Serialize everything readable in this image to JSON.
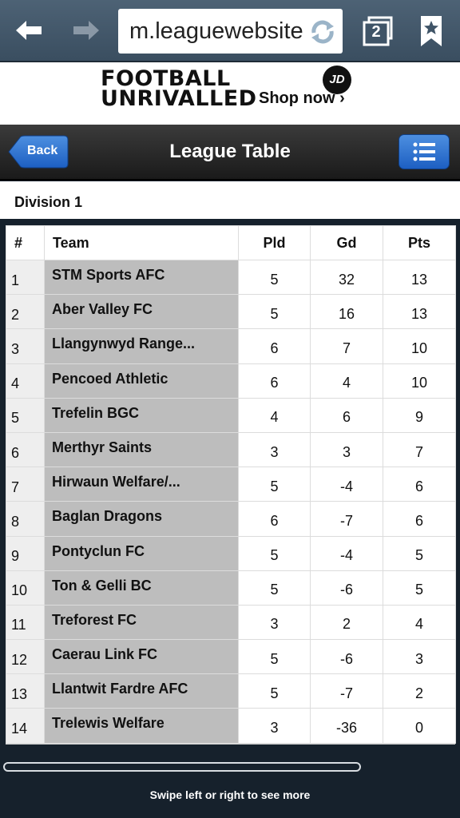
{
  "browser": {
    "url": "m.leaguewebsite",
    "tab_count": "2",
    "icons": {
      "back": "left-arrow-icon",
      "forward": "right-arrow-icon",
      "reload": "reload-icon",
      "tabs": "tabs-icon",
      "bookmark": "bookmark-star-icon"
    }
  },
  "ad": {
    "line1": "FOOTBALL",
    "line2": "UNRIVALLED",
    "cta": "Shop now ›",
    "logo": "JD"
  },
  "header": {
    "back_label": "Back",
    "title": "League Table",
    "menu_icon": "list-menu-icon",
    "accent": "#2a6fd4"
  },
  "division": "Division 1",
  "table": {
    "columns": [
      "#",
      "Team",
      "Pld",
      "Gd",
      "Pts"
    ],
    "rows": [
      {
        "pos": "1",
        "team": "STM Sports AFC",
        "pld": "5",
        "gd": "32",
        "pts": "13"
      },
      {
        "pos": "2",
        "team": "Aber Valley FC",
        "pld": "5",
        "gd": "16",
        "pts": "13"
      },
      {
        "pos": "3",
        "team": "Llangynwyd Range...",
        "pld": "6",
        "gd": "7",
        "pts": "10"
      },
      {
        "pos": "4",
        "team": "Pencoed Athletic",
        "pld": "6",
        "gd": "4",
        "pts": "10"
      },
      {
        "pos": "5",
        "team": "Trefelin BGC",
        "pld": "4",
        "gd": "6",
        "pts": "9"
      },
      {
        "pos": "6",
        "team": "Merthyr Saints",
        "pld": "3",
        "gd": "3",
        "pts": "7"
      },
      {
        "pos": "7",
        "team": "Hirwaun Welfare/...",
        "pld": "5",
        "gd": "-4",
        "pts": "6"
      },
      {
        "pos": "8",
        "team": "Baglan Dragons",
        "pld": "6",
        "gd": "-7",
        "pts": "6"
      },
      {
        "pos": "9",
        "team": "Pontyclun FC",
        "pld": "5",
        "gd": "-4",
        "pts": "5"
      },
      {
        "pos": "10",
        "team": "Ton & Gelli BC",
        "pld": "5",
        "gd": "-6",
        "pts": "5"
      },
      {
        "pos": "11",
        "team": "Treforest FC",
        "pld": "3",
        "gd": "2",
        "pts": "4"
      },
      {
        "pos": "12",
        "team": "Caerau Link FC",
        "pld": "5",
        "gd": "-6",
        "pts": "3"
      },
      {
        "pos": "13",
        "team": "Llantwit Fardre AFC",
        "pld": "5",
        "gd": "-7",
        "pts": "2"
      },
      {
        "pos": "14",
        "team": "Trelewis Welfare",
        "pld": "3",
        "gd": "-36",
        "pts": "0"
      }
    ]
  },
  "footer": {
    "hint": "Swipe left or right to see more"
  }
}
